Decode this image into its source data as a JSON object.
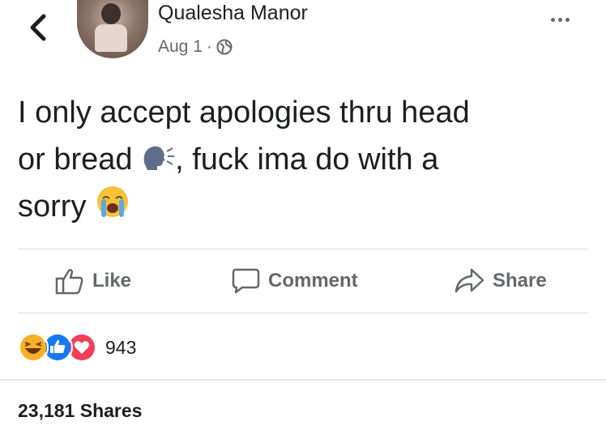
{
  "header": {
    "author": "Qualesha Manor",
    "date": "Aug 1",
    "dot": "·",
    "privacy_icon": "globe-icon"
  },
  "post": {
    "line1": "I only accept apologies thru head",
    "line2a": "or bread",
    "line2b": ", fuck ima do with a",
    "line3": "sorry",
    "emoji1": "speaking-head-icon",
    "emoji2": "crying-face-icon"
  },
  "actions": {
    "like": "Like",
    "comment": "Comment",
    "share": "Share"
  },
  "reactions": {
    "icons": [
      "haha-icon",
      "like-icon",
      "love-icon"
    ],
    "count": "943"
  },
  "footer": {
    "shares": "23,181 Shares"
  },
  "colors": {
    "text": "#1c1e21",
    "muted": "#65676b",
    "like_blue": "#1877f2",
    "love_red": "#f33e58",
    "haha_yellow": "#f7b125"
  }
}
